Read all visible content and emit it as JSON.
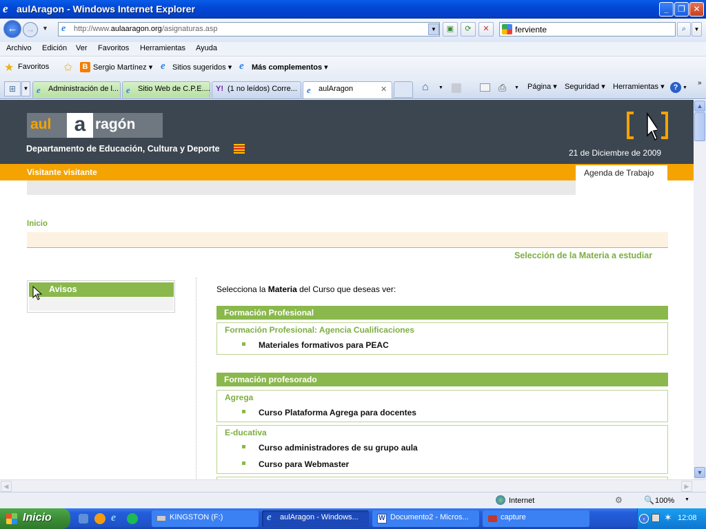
{
  "window": {
    "title": "aulAragon - Windows Internet Explorer"
  },
  "nav": {
    "url_prefix": "http://www.",
    "url_domain": "aulaaragon.org",
    "url_path": "/asignaturas.asp",
    "search_value": "ferviente"
  },
  "menu": [
    "Archivo",
    "Edición",
    "Ver",
    "Favoritos",
    "Herramientas",
    "Ayuda"
  ],
  "favorites": {
    "label": "Favoritos",
    "items": [
      "Sergio Martínez ▾",
      "Sitios sugeridos ▾",
      "Más complementos ▾"
    ]
  },
  "tabs": [
    "Administración de l...",
    "Sitio Web de C.P.E....",
    "(1 no leídos) Corre...",
    "aulAragon"
  ],
  "commands": [
    "Página ▾",
    "Seguridad ▾",
    "Herramientas ▾"
  ],
  "site": {
    "logo_left": "aul",
    "logo_a": "a",
    "logo_right": "ragón",
    "department": "Departamento de Educación, Cultura y Deporte",
    "date": "21 de Diciembre de 2009",
    "user": "Visitante visitante",
    "agenda": "Agenda de Trabajo",
    "breadcrumb": "Inicio",
    "section_title": "Selección de la Materia a estudiar",
    "avisos": "Avisos",
    "intro_before": "Selecciona la ",
    "intro_bold": "Materia",
    "intro_after": " del Curso que deseas ver:",
    "sections": [
      {
        "title": "Formación Profesional",
        "groups": [
          {
            "title": "Formación Profesional: Agencia Cualificaciones",
            "items": [
              "Materiales formativos para PEAC"
            ]
          }
        ]
      },
      {
        "title": "Formación profesorado",
        "groups": [
          {
            "title": "Agrega",
            "items": [
              "Curso Plataforma Agrega para docentes"
            ]
          },
          {
            "title": "E-ducativa",
            "items": [
              "Curso administradores de su grupo aula",
              "Curso para Webmaster"
            ]
          }
        ]
      }
    ]
  },
  "status": {
    "zone": "Internet",
    "zoom": "100%"
  },
  "taskbar": {
    "start": "Inicio",
    "tasks": [
      "KINGSTON (F:)",
      "aulAragon - Windows...",
      "Documento2 - Micros...",
      "capture"
    ],
    "clock": "12:08"
  },
  "colors": {
    "accent_green": "#8ab84c",
    "orange": "#f5a300",
    "header_dark": "#3c4650"
  }
}
